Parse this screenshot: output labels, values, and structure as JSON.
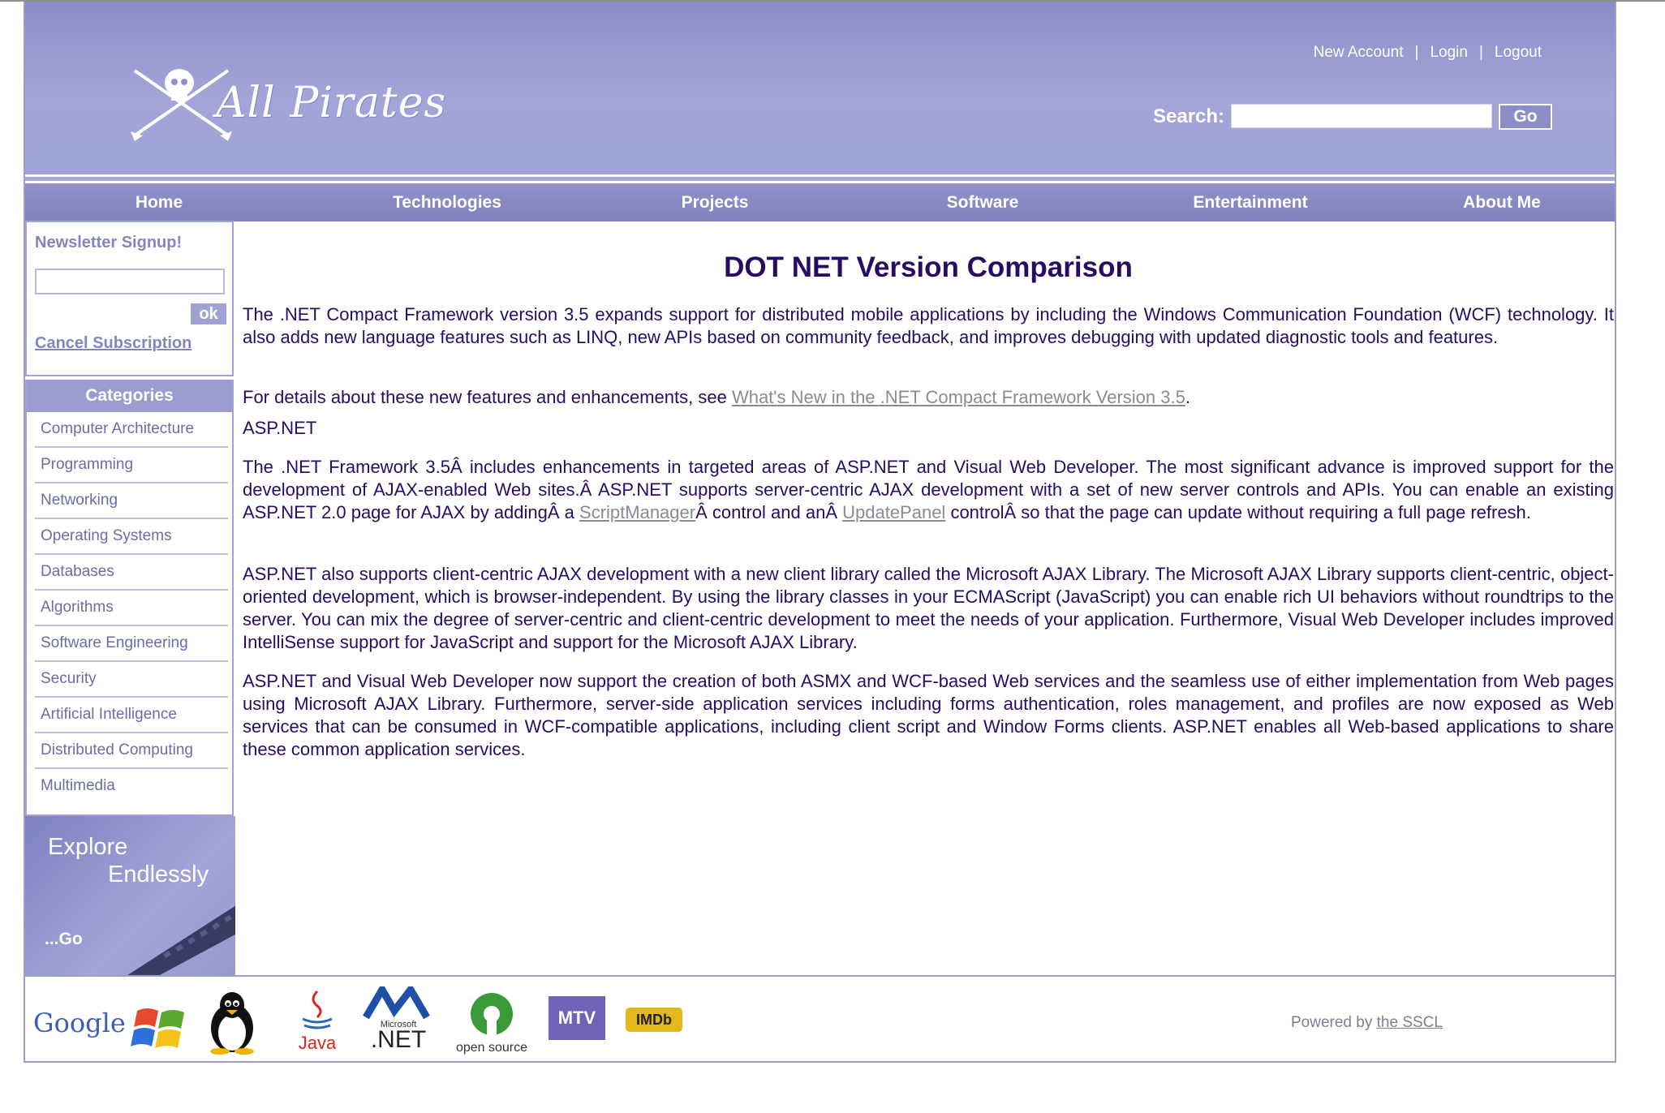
{
  "header": {
    "logo_text": "All Pirates",
    "links": [
      "New Account",
      "Login",
      "Logout"
    ],
    "search_label": "Search:",
    "search_value": "",
    "go_label": "Go"
  },
  "nav": [
    "Home",
    "Technologies",
    "Projects",
    "Software",
    "Entertainment",
    "About Me"
  ],
  "newsletter": {
    "title": "Newsletter Signup!",
    "input_value": "",
    "ok_label": "ok",
    "cancel_label": "Cancel Subscription"
  },
  "categories": {
    "title": "Categories",
    "items": [
      "Computer Architecture",
      "Programming",
      "Networking",
      "Operating Systems",
      "Databases",
      "Algorithms",
      "Software Engineering",
      "Security",
      "Artificial Intelligence",
      "Distributed Computing",
      "Multimedia"
    ]
  },
  "explore": {
    "line1": "Explore",
    "line2": "Endlessly",
    "go": "...Go"
  },
  "main": {
    "title": "DOT NET Version Comparison",
    "p1": "The .NET Compact Framework version 3.5 expands support for distributed mobile applications by including the Windows Communication Foundation (WCF) technology. It also adds new language features such as LINQ, new APIs based on community feedback, and improves debugging with updated diagnostic tools and features.",
    "p2_prefix": "For details about these new features and enhancements, see ",
    "p2_link": "What's New in the .NET Compact Framework Version 3.5",
    "p2_suffix": ".",
    "heading_asp": "ASP.NET",
    "p3_a": "The .NET Framework 3.5Â includes enhancements in targeted areas of ASP.NET and Visual Web Developer. The most significant advance is improved support for the development of AJAX-enabled Web sites.Â ASP.NET supports server-centric AJAX development with a set of new server controls and APIs. You can enable an existing ASP.NET 2.0 page for AJAX by addingÂ a ",
    "p3_link1": "ScriptManager",
    "p3_b": "Â control and anÂ ",
    "p3_link2": "UpdatePanel",
    "p3_c": " controlÂ so that the page can update without requiring a full page refresh.",
    "p4": "ASP.NET also supports client-centric AJAX development with a new client library called the Microsoft AJAX Library. The Microsoft AJAX Library supports client-centric, object-oriented development, which is browser-independent. By using the library classes in your ECMAScript (JavaScript) you can enable rich UI behaviors without roundtrips to the server. You can mix the degree of server-centric and client-centric development to meet the needs of your application. Furthermore, Visual Web Developer includes improved IntelliSense support for JavaScript and support for the Microsoft AJAX Library.",
    "p5": "ASP.NET and Visual Web Developer now support the creation of both ASMX and WCF-based Web services and the seamless use of either implementation from Web pages using Microsoft AJAX Library. Furthermore, server-side application services including forms authentication, roles management, and profiles are now exposed as Web services that can be consumed in WCF-compatible applications, including client script and Window Forms clients. ASP.NET enables all Web-based applications to share these common application services."
  },
  "footer": {
    "logos": [
      "Google",
      "Windows",
      "Linux",
      "Java",
      "Microsoft .NET",
      "open source",
      "MTV",
      "IMDb"
    ],
    "logo_texts": {
      "google": "Google",
      "java": "Java",
      "dotnet_small": "Microsoft",
      "dotnet_big": ".NET",
      "opensource": "open source",
      "mtv": "MTV",
      "imdb": "IMDb"
    },
    "powered_prefix": "Powered by ",
    "powered_link": "the SSCL"
  }
}
